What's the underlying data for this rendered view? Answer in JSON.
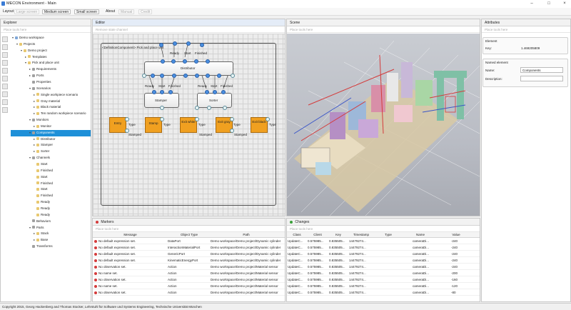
{
  "window": {
    "title": "MECON Environment - Main"
  },
  "menu": {
    "layout": "Layout",
    "large_screen": "Large screen",
    "medium_screen": "Medium screen",
    "small_screen": "Small screen",
    "about": "About",
    "manual": "Manual",
    "credit": "Credit"
  },
  "explorer": {
    "title": "Explorer",
    "filter": "Place tools here",
    "tree": [
      {
        "label": "Demo workspace",
        "depth": 0,
        "open": true
      },
      {
        "label": "Projects",
        "depth": 1,
        "open": true
      },
      {
        "label": "Demo project",
        "depth": 2,
        "open": true
      },
      {
        "label": "Templates",
        "depth": 3,
        "open": false
      },
      {
        "label": "Pick and place unit",
        "depth": 3,
        "open": true
      },
      {
        "label": "Requirements",
        "depth": 4,
        "open": false
      },
      {
        "label": "Ports",
        "depth": 4,
        "open": false
      },
      {
        "label": "Properties",
        "depth": 4,
        "open": null
      },
      {
        "label": "Scenarios",
        "depth": 4,
        "open": true
      },
      {
        "label": "Single workpiece scenario",
        "depth": 5,
        "open": false
      },
      {
        "label": "Gray material",
        "depth": 5,
        "open": false
      },
      {
        "label": "Black material",
        "depth": 5,
        "open": false
      },
      {
        "label": "Ten random workpiece scenario",
        "depth": 5,
        "open": false
      },
      {
        "label": "Monitors",
        "depth": 4,
        "open": true
      },
      {
        "label": "Monitor",
        "depth": 5,
        "open": false
      },
      {
        "label": "Components",
        "depth": 4,
        "open": true,
        "selected": true
      },
      {
        "label": "Distributor",
        "depth": 5,
        "open": false
      },
      {
        "label": "Stamper",
        "depth": 5,
        "open": false
      },
      {
        "label": "Sorter",
        "depth": 5,
        "open": false
      },
      {
        "label": "Channels",
        "depth": 4,
        "open": true
      },
      {
        "label": "Start",
        "depth": 5,
        "open": null
      },
      {
        "label": "Finished",
        "depth": 5,
        "open": null
      },
      {
        "label": "Start",
        "depth": 5,
        "open": null
      },
      {
        "label": "Finished",
        "depth": 5,
        "open": null
      },
      {
        "label": "Start",
        "depth": 5,
        "open": null
      },
      {
        "label": "Finished",
        "depth": 5,
        "open": null
      },
      {
        "label": "Ready",
        "depth": 5,
        "open": null
      },
      {
        "label": "Ready",
        "depth": 5,
        "open": null
      },
      {
        "label": "Ready",
        "depth": 5,
        "open": null
      },
      {
        "label": "Behaviors",
        "depth": 4,
        "open": null
      },
      {
        "label": "Parts",
        "depth": 4,
        "open": true
      },
      {
        "label": "Stack",
        "depth": 5,
        "open": false
      },
      {
        "label": "Base",
        "depth": 5,
        "open": false
      },
      {
        "label": "Transforms",
        "depth": 4,
        "open": null
      }
    ]
  },
  "editor": {
    "title": "Editor",
    "filter": "Remove state channel",
    "frame_title": "<DefinitionComponent> Pick and place unit",
    "distributor": "Distributor",
    "stamper": "Stamper",
    "sorter": "Sorter",
    "top_labels": {
      "ready": "Ready",
      "start": "Start",
      "finished": "Finished"
    },
    "dist_labels": [
      "Ready",
      "Start",
      "Finished",
      "Ready",
      "Start",
      "Finished"
    ],
    "stamper_labels": [
      "Ready",
      "Start",
      "Finished"
    ],
    "sorter_labels": [
      "Ready",
      "Start",
      "Finished"
    ],
    "outputs": [
      {
        "label": "Entry",
        "side": "Type"
      },
      {
        "label": "Stamp",
        "side": "Type"
      },
      {
        "label": "Exit white",
        "side": "Type"
      },
      {
        "label": "Exit gray",
        "side": "Type"
      },
      {
        "label": "Exit black",
        "side": "Type"
      }
    ],
    "stamped": [
      "Stamped",
      "Stamped",
      "Stamped"
    ]
  },
  "scene": {
    "title": "Scene",
    "filter": "Place tools here"
  },
  "attributes": {
    "title": "Attributes",
    "filter": "Place tools here",
    "element_section": "Element",
    "key_label": "Key:",
    "key_value": "1.469205809",
    "named_section": "Named element",
    "name_label": "Name:",
    "name_value": "Components",
    "desc_label": "Description:",
    "desc_value": ""
  },
  "markers": {
    "title": "Markers",
    "filter": "Place tools here",
    "columns": [
      "Message",
      "Object Type",
      "Path"
    ],
    "rows": [
      [
        "No default expression set.",
        "DataPort",
        "Demo workspace/Demo project/Dynamic cylinder"
      ],
      [
        "No default expression set.",
        "InteractionMaterialPort",
        "Demo workspace/Demo project/Dynamic cylinder"
      ],
      [
        "No default expression set.",
        "GenericPort",
        "Demo workspace/Demo project/Dynamic cylinder"
      ],
      [
        "No default expression set.",
        "KinematicEnergyPort",
        "Demo workspace/Demo project/Dynamic cylinder"
      ],
      [
        "No observation set.",
        "Action",
        "Demo workspace/Demo project/Material sensor"
      ],
      [
        "No name set.",
        "Action",
        "Demo workspace/Demo project/Material sensor"
      ],
      [
        "No observation set.",
        "Action",
        "Demo workspace/Demo project/Material sensor"
      ],
      [
        "No name set.",
        "Action",
        "Demo workspace/Demo project/Material sensor"
      ],
      [
        "No observation set.",
        "Action",
        "Demo workspace/Demo project/Material sensor"
      ]
    ]
  },
  "changes": {
    "title": "Changes",
    "filter": "Place tools here",
    "columns": [
      "Class",
      "Client",
      "Key",
      "Timestamp",
      "Type",
      "Name",
      "Value"
    ],
    "rows": [
      [
        "UpdateC...",
        "0.575985...",
        "0.835505...",
        "14479274...",
        "",
        "cameraDi...",
        "-240"
      ],
      [
        "UpdateC...",
        "0.575985...",
        "0.835505...",
        "14479274...",
        "",
        "cameraDi...",
        "-240"
      ],
      [
        "UpdateC...",
        "0.575985...",
        "0.835505...",
        "14479274...",
        "",
        "cameraDi...",
        "-240"
      ],
      [
        "UpdateC...",
        "0.575985...",
        "0.835505...",
        "14479274...",
        "",
        "cameraDi...",
        "-240"
      ],
      [
        "UpdateC...",
        "0.575985...",
        "0.835505...",
        "14479274...",
        "",
        "cameraDi...",
        "-240"
      ],
      [
        "UpdateC...",
        "0.575985...",
        "0.835505...",
        "14479274...",
        "",
        "cameraDi...",
        "-200"
      ],
      [
        "UpdateC...",
        "0.575985...",
        "0.835505...",
        "14479274...",
        "",
        "cameraDi...",
        "-160"
      ],
      [
        "UpdateC...",
        "0.575985...",
        "0.835505...",
        "14479274...",
        "",
        "cameraDi...",
        "-120"
      ],
      [
        "UpdateC...",
        "0.575985...",
        "0.835505...",
        "14479274...",
        "",
        "cameraDi...",
        "-80"
      ]
    ]
  },
  "status": {
    "text": "Copyright 2015, Georg Hackenberg and Thomas Stocker, Lehrstuhl für Software und Systems Engineering, Technische Universität München"
  },
  "colors": {
    "selection": "#1e90d8",
    "port": "#4a8fe0",
    "output": "#f0a020",
    "error": "#d43b3b"
  }
}
